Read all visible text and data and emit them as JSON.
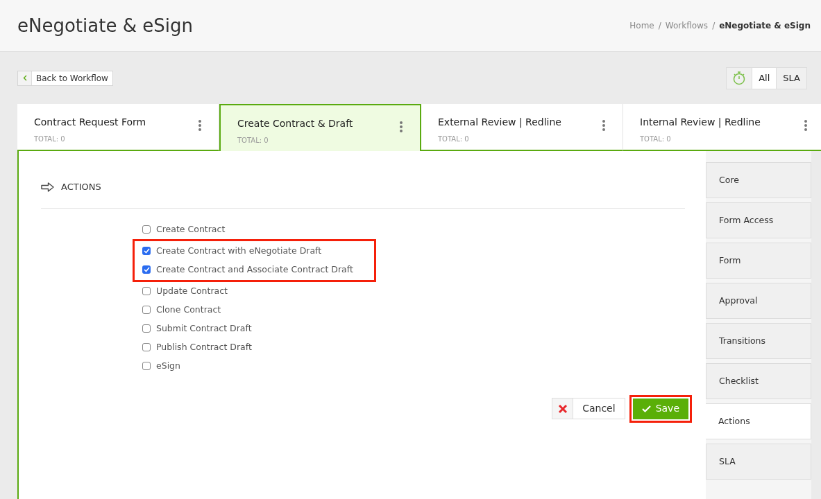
{
  "page_title": "eNegotiate & eSign",
  "breadcrumbs": [
    {
      "label": "Home",
      "separator": "/",
      "current": false
    },
    {
      "label": "Workflows",
      "separator": "/",
      "current": false
    },
    {
      "label": "eNegotiate & eSign",
      "current": true
    }
  ],
  "back_button": {
    "label": "Back to Workflow"
  },
  "filter_toggle": [
    {
      "label": "All",
      "selected": true
    },
    {
      "label": "SLA",
      "selected": false
    }
  ],
  "stages": [
    {
      "name": "Contract Request Form",
      "total": "TOTAL: 0",
      "selected": false
    },
    {
      "name": "Create Contract & Draft",
      "total": "TOTAL: 0",
      "selected": true
    },
    {
      "name": "External Review | Redline",
      "total": "TOTAL: 0",
      "selected": false
    },
    {
      "name": "Internal Review | Redline",
      "total": "TOTAL: 0",
      "selected": false
    }
  ],
  "section": {
    "title": "ACTIONS"
  },
  "actions": [
    {
      "label": "Create Contract",
      "checked": false,
      "highlighted": false
    },
    {
      "label": "Create Contract with eNegotiate Draft",
      "checked": true,
      "highlighted": true
    },
    {
      "label": "Create Contract and Associate Contract Draft",
      "checked": true,
      "highlighted": true
    },
    {
      "label": "Update Contract",
      "checked": false,
      "highlighted": false
    },
    {
      "label": "Clone Contract",
      "checked": false,
      "highlighted": false
    },
    {
      "label": "Submit Contract Draft",
      "checked": false,
      "highlighted": false
    },
    {
      "label": "Publish Contract Draft",
      "checked": false,
      "highlighted": false
    },
    {
      "label": "eSign",
      "checked": false,
      "highlighted": false
    }
  ],
  "buttons": {
    "cancel": {
      "label": "Cancel",
      "highlighted": false
    },
    "save": {
      "label": "Save",
      "highlighted": true
    }
  },
  "side_tabs": [
    {
      "label": "Core",
      "selected": false
    },
    {
      "label": "Form Access",
      "selected": false
    },
    {
      "label": "Form",
      "selected": false
    },
    {
      "label": "Approval",
      "selected": false
    },
    {
      "label": "Transitions",
      "selected": false
    },
    {
      "label": "Checklist",
      "selected": false
    },
    {
      "label": "Actions",
      "selected": true
    },
    {
      "label": "SLA",
      "selected": false
    }
  ]
}
